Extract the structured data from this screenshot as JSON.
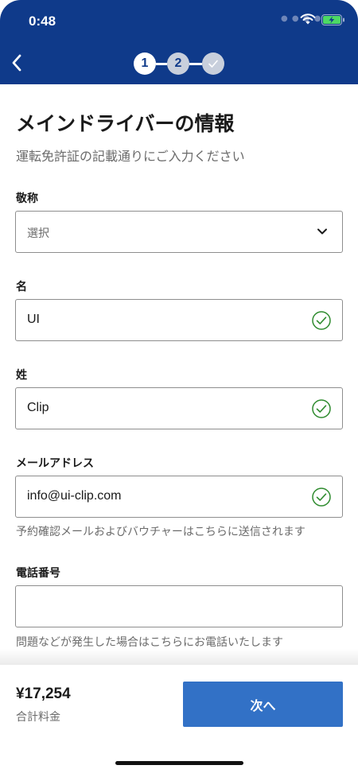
{
  "status_bar": {
    "time": "0:48",
    "signal_icon": "signal-dots-icon",
    "wifi_icon": "wifi-icon",
    "battery_icon": "battery-charging-icon"
  },
  "header": {
    "background_color": "#0f3a8a",
    "back_icon": "chevron-left-icon",
    "steps": [
      {
        "label": "1",
        "state": "current"
      },
      {
        "label": "2",
        "state": "upcoming"
      },
      {
        "label": "",
        "icon": "checkmark-icon",
        "state": "upcoming"
      }
    ]
  },
  "main": {
    "title": "メインドライバーの情報",
    "subtitle": "運転免許証の記載通りにご入力ください",
    "fields": {
      "honorific": {
        "label": "敬称",
        "placeholder": "選択",
        "value": "",
        "icon": "chevron-down-icon"
      },
      "first_name": {
        "label": "名",
        "value": "UI",
        "valid": true,
        "icon": "check-circle-icon"
      },
      "last_name": {
        "label": "姓",
        "value": "Clip",
        "valid": true,
        "icon": "check-circle-icon"
      },
      "email": {
        "label": "メールアドレス",
        "value": "info@ui-clip.com",
        "valid": true,
        "icon": "check-circle-icon",
        "helper": "予約確認メールおよびバウチャーはこちらに送信されます"
      },
      "phone": {
        "label": "電話番号",
        "value": "",
        "helper": "問題などが発生した場合はこちらにお電話いたします"
      }
    }
  },
  "footer": {
    "price": "¥17,254",
    "price_label": "合計料金",
    "next_label": "次へ",
    "button_color": "#3271c6",
    "valid_color": "#2e8b2e"
  }
}
